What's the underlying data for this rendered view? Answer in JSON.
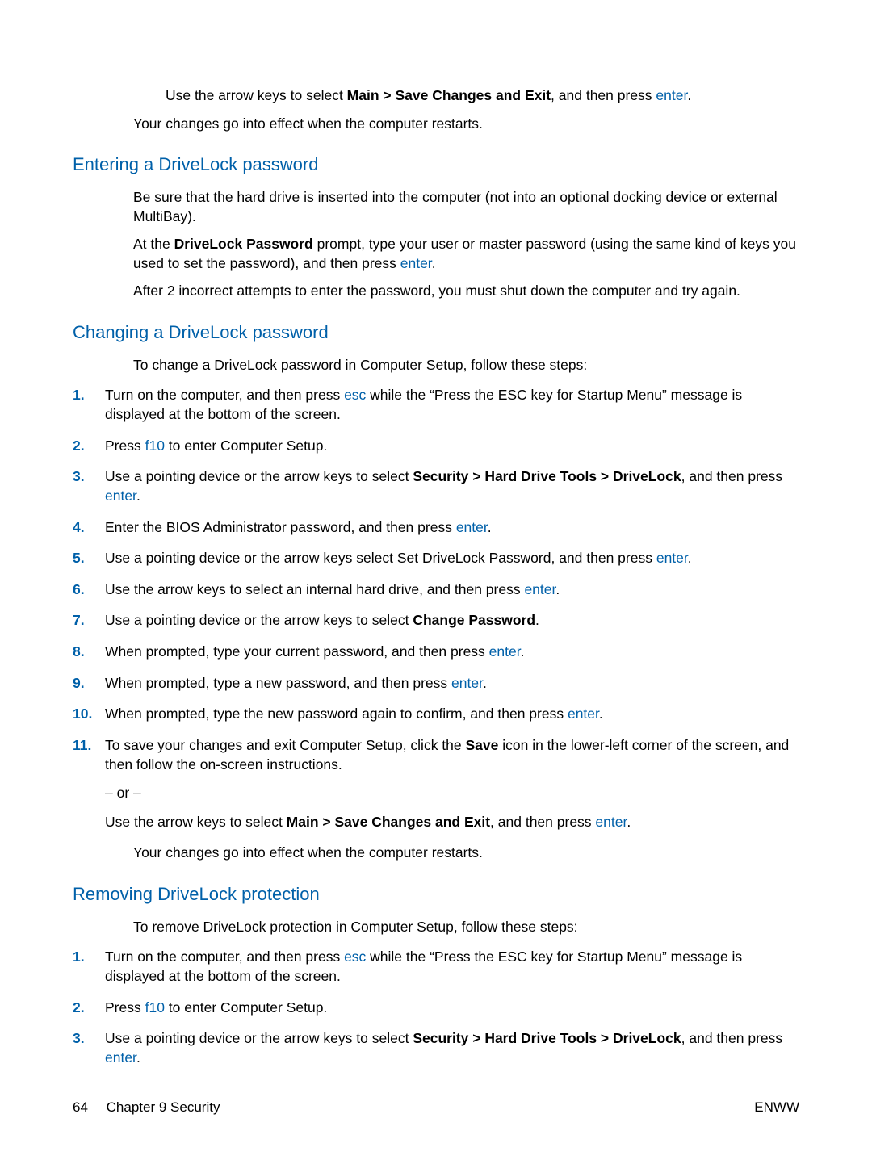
{
  "intro": {
    "line1_pre": "Use the arrow keys to select ",
    "line1_bold": "Main > Save Changes and Exit",
    "line1_mid": ", and then press ",
    "line1_key": "enter",
    "line1_post": ".",
    "line2": "Your changes go into effect when the computer restarts."
  },
  "section1": {
    "heading": "Entering a DriveLock password",
    "p1": "Be sure that the hard drive is inserted into the computer (not into an optional docking device or external MultiBay).",
    "p2_pre": "At the ",
    "p2_bold": "DriveLock Password",
    "p2_mid": " prompt, type your user or master password (using the same kind of keys you used to set the password), and then press ",
    "p2_key": "enter",
    "p2_post": ".",
    "p3": "After 2 incorrect attempts to enter the password, you must shut down the computer and try again."
  },
  "section2": {
    "heading": "Changing a DriveLock password",
    "intro": "To change a DriveLock password in Computer Setup, follow these steps:",
    "steps": [
      {
        "num": "1.",
        "parts": [
          {
            "t": "Turn on the computer, and then press "
          },
          {
            "t": "esc",
            "cls": "key"
          },
          {
            "t": " while the “Press the ESC key for Startup Menu” message is displayed at the bottom of the screen."
          }
        ]
      },
      {
        "num": "2.",
        "parts": [
          {
            "t": "Press "
          },
          {
            "t": "f10",
            "cls": "key"
          },
          {
            "t": " to enter Computer Setup."
          }
        ]
      },
      {
        "num": "3.",
        "parts": [
          {
            "t": "Use a pointing device or the arrow keys to select "
          },
          {
            "t": "Security > Hard Drive Tools > DriveLock",
            "cls": "bold"
          },
          {
            "t": ", and then press "
          },
          {
            "t": "enter",
            "cls": "key"
          },
          {
            "t": "."
          }
        ]
      },
      {
        "num": "4.",
        "parts": [
          {
            "t": "Enter the BIOS Administrator password, and then press "
          },
          {
            "t": "enter",
            "cls": "key"
          },
          {
            "t": "."
          }
        ]
      },
      {
        "num": "5.",
        "parts": [
          {
            "t": "Use a pointing device or the arrow keys select Set DriveLock Password, and then press "
          },
          {
            "t": "enter",
            "cls": "key"
          },
          {
            "t": "."
          }
        ]
      },
      {
        "num": "6.",
        "parts": [
          {
            "t": "Use the arrow keys to select an internal hard drive, and then press "
          },
          {
            "t": "enter",
            "cls": "key"
          },
          {
            "t": "."
          }
        ]
      },
      {
        "num": "7.",
        "parts": [
          {
            "t": "Use a pointing device or the arrow keys to select "
          },
          {
            "t": "Change Password",
            "cls": "bold"
          },
          {
            "t": "."
          }
        ]
      },
      {
        "num": "8.",
        "parts": [
          {
            "t": "When prompted, type your current password, and then press "
          },
          {
            "t": "enter",
            "cls": "key"
          },
          {
            "t": "."
          }
        ]
      },
      {
        "num": "9.",
        "parts": [
          {
            "t": "When prompted, type a new password, and then press "
          },
          {
            "t": "enter",
            "cls": "key"
          },
          {
            "t": "."
          }
        ]
      },
      {
        "num": "10.",
        "parts": [
          {
            "t": "When prompted, type the new password again to confirm, and then press "
          },
          {
            "t": "enter",
            "cls": "key"
          },
          {
            "t": "."
          }
        ]
      },
      {
        "num": "11.",
        "parts": [
          {
            "t": "To save your changes and exit Computer Setup, click the "
          },
          {
            "t": "Save",
            "cls": "bold"
          },
          {
            "t": " icon in the lower-left corner of the screen, and then follow the on-screen instructions."
          }
        ],
        "extra": [
          {
            "parts": [
              {
                "t": "– or –"
              }
            ]
          },
          {
            "parts": [
              {
                "t": "Use the arrow keys to select "
              },
              {
                "t": "Main > Save Changes and Exit",
                "cls": "bold"
              },
              {
                "t": ", and then press "
              },
              {
                "t": "enter",
                "cls": "key"
              },
              {
                "t": "."
              }
            ]
          }
        ]
      }
    ],
    "outro": "Your changes go into effect when the computer restarts."
  },
  "section3": {
    "heading": "Removing DriveLock protection",
    "intro": "To remove DriveLock protection in Computer Setup, follow these steps:",
    "steps": [
      {
        "num": "1.",
        "parts": [
          {
            "t": "Turn on the computer, and then press "
          },
          {
            "t": "esc",
            "cls": "key"
          },
          {
            "t": " while the “Press the ESC key for Startup Menu” message is displayed at the bottom of the screen."
          }
        ]
      },
      {
        "num": "2.",
        "parts": [
          {
            "t": "Press "
          },
          {
            "t": "f10",
            "cls": "key"
          },
          {
            "t": " to enter Computer Setup."
          }
        ]
      },
      {
        "num": "3.",
        "parts": [
          {
            "t": "Use a pointing device or the arrow keys to select "
          },
          {
            "t": "Security > Hard Drive Tools > DriveLock",
            "cls": "bold"
          },
          {
            "t": ", and then press "
          },
          {
            "t": "enter",
            "cls": "key"
          },
          {
            "t": "."
          }
        ]
      }
    ]
  },
  "footer": {
    "page": "64",
    "chapter": "Chapter 9   Security",
    "right": "ENWW"
  }
}
